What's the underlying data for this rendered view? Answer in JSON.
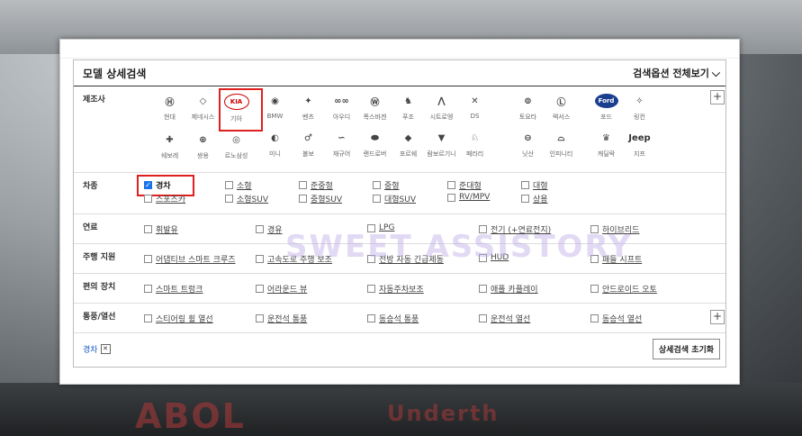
{
  "background": {
    "text1": "ABOL",
    "text2": "Underth"
  },
  "panel": {
    "title": "모델 상세검색",
    "expand_label": "검색옵션 전체보기",
    "maker": {
      "label": "제조사",
      "group1": [
        {
          "name": "현대",
          "icon": "hyundai-logo",
          "glyph": "Ⓗ"
        },
        {
          "name": "제네시스",
          "icon": "genesis-logo",
          "glyph": "◇"
        },
        {
          "name": "기아",
          "icon": "kia-logo",
          "glyph": "KIA"
        },
        {
          "name": "쉐보레",
          "icon": "chevrolet-logo",
          "glyph": "✚"
        },
        {
          "name": "쌍용",
          "icon": "ssangyong-logo",
          "glyph": "⊕"
        },
        {
          "name": "르노삼성",
          "icon": "renault-samsung-logo",
          "glyph": "◎"
        }
      ],
      "group2": [
        {
          "name": "BMW",
          "icon": "bmw-logo",
          "glyph": "◉"
        },
        {
          "name": "벤츠",
          "icon": "benz-logo",
          "glyph": "✦"
        },
        {
          "name": "아우디",
          "icon": "audi-logo",
          "glyph": "∞∞"
        },
        {
          "name": "폭스바겐",
          "icon": "volkswagen-logo",
          "glyph": "Ⓦ"
        },
        {
          "name": "푸조",
          "icon": "peugeot-logo",
          "glyph": "♞"
        },
        {
          "name": "시트로엥",
          "icon": "citroen-logo",
          "glyph": "⋀"
        },
        {
          "name": "DS",
          "icon": "ds-logo",
          "glyph": "✕"
        },
        {
          "name": "미니",
          "icon": "mini-logo",
          "glyph": "◐"
        },
        {
          "name": "볼보",
          "icon": "volvo-logo",
          "glyph": "♂"
        },
        {
          "name": "재규어",
          "icon": "jaguar-logo",
          "glyph": "∽"
        },
        {
          "name": "랜드로버",
          "icon": "landrover-logo",
          "glyph": "⬬"
        },
        {
          "name": "포르쉐",
          "icon": "porsche-logo",
          "glyph": "◆"
        },
        {
          "name": "람보르기니",
          "icon": "lamborghini-logo",
          "glyph": "▼"
        },
        {
          "name": "페라리",
          "icon": "ferrari-logo",
          "glyph": "♘"
        }
      ],
      "group3": [
        {
          "name": "토요타",
          "icon": "toyota-logo",
          "glyph": "⊚"
        },
        {
          "name": "렉서스",
          "icon": "lexus-logo",
          "glyph": "Ⓛ"
        },
        {
          "name": "닛산",
          "icon": "nissan-logo",
          "glyph": "⊖"
        },
        {
          "name": "인피니티",
          "icon": "infiniti-logo",
          "glyph": "⌓"
        }
      ],
      "group4": [
        {
          "name": "포드",
          "icon": "ford-logo",
          "glyph": "Ford"
        },
        {
          "name": "링컨",
          "icon": "lincoln-logo",
          "glyph": "✧"
        },
        {
          "name": "캐딜락",
          "icon": "cadillac-logo",
          "glyph": "♛"
        },
        {
          "name": "지프",
          "icon": "jeep-logo",
          "glyph": "Jeep"
        }
      ]
    },
    "vehicle_type": {
      "label": "차종",
      "options": [
        {
          "label": "경차",
          "checked": true
        },
        {
          "label": "소형",
          "checked": false
        },
        {
          "label": "준중형",
          "checked": false
        },
        {
          "label": "중형",
          "checked": false
        },
        {
          "label": "준대형",
          "checked": false
        },
        {
          "label": "대형",
          "checked": false
        },
        {
          "label": "스포츠카",
          "checked": false
        },
        {
          "label": "소형SUV",
          "checked": false
        },
        {
          "label": "중형SUV",
          "checked": false
        },
        {
          "label": "대형SUV",
          "checked": false
        },
        {
          "label": "RV/MPV",
          "checked": false
        },
        {
          "label": "상용",
          "checked": false
        }
      ]
    },
    "fuel": {
      "label": "연료",
      "options": [
        "휘발유",
        "경유",
        "LPG",
        "전기 (+연료전지)",
        "하이브리드"
      ]
    },
    "driving": {
      "label": "주행 지원",
      "options": [
        "어댑티브 스마트 크루즈",
        "고속도로 주행 보조",
        "전방 자동 긴급제동",
        "HUD",
        "패들 시프트"
      ]
    },
    "convenience": {
      "label": "편의 장치",
      "options": [
        "스마트 트렁크",
        "어라운드 뷰",
        "자동주차보조",
        "애플 카플레이",
        "안드로이드 오토"
      ]
    },
    "ventilation": {
      "label": "통풍/열선",
      "options": [
        "스티어링 휠 열선",
        "운전석 통풍",
        "동승석 통풍",
        "운전석 열선",
        "동승석 열선"
      ]
    },
    "selected_chip": "경차",
    "reset_label": "상세검색 초기화",
    "watermark": "SWEET ASSISTORY"
  },
  "colors": {
    "highlight": "#e02020",
    "check": "#1a73e8"
  }
}
